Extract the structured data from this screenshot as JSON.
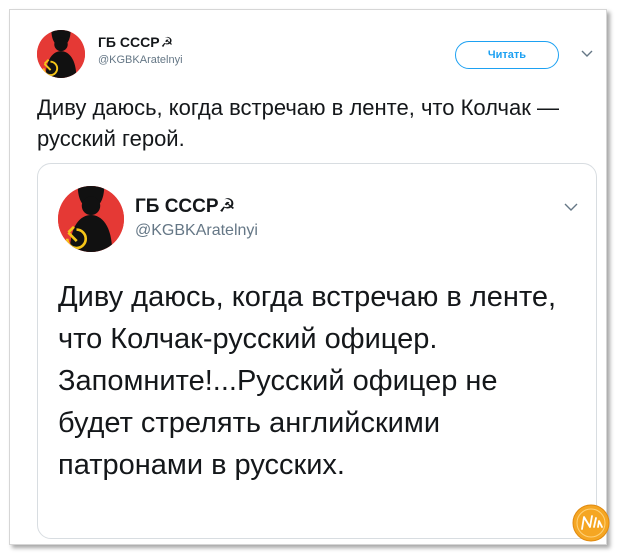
{
  "outer_tweet": {
    "display_name": "ГБ СССР",
    "name_symbol": "☭",
    "handle": "@KGBKAratelnyi",
    "follow_label": "Читать",
    "text": "Диву даюсь, когда встречаю в ленте, что Колчак — русский герой."
  },
  "quoted_tweet": {
    "display_name": "ГБ СССР",
    "name_symbol": "☭",
    "handle": "@KGBKAratelnyi",
    "text": "Диву даюсь, когда встречаю в ленте, что Колчак-русский офицер. Запомните!...Русский офицер не будет стрелять английскими патронами в русских."
  },
  "watermark": {
    "text": "Nika"
  },
  "icons": {
    "avatar": "hammer-sickle-avatar-icon",
    "caret": "chevron-down-icon"
  },
  "colors": {
    "avatar_red": "#e53935",
    "follow_blue": "#1da1f2",
    "text": "#14171a",
    "muted": "#657786",
    "watermark_orange": "#f5a623"
  }
}
